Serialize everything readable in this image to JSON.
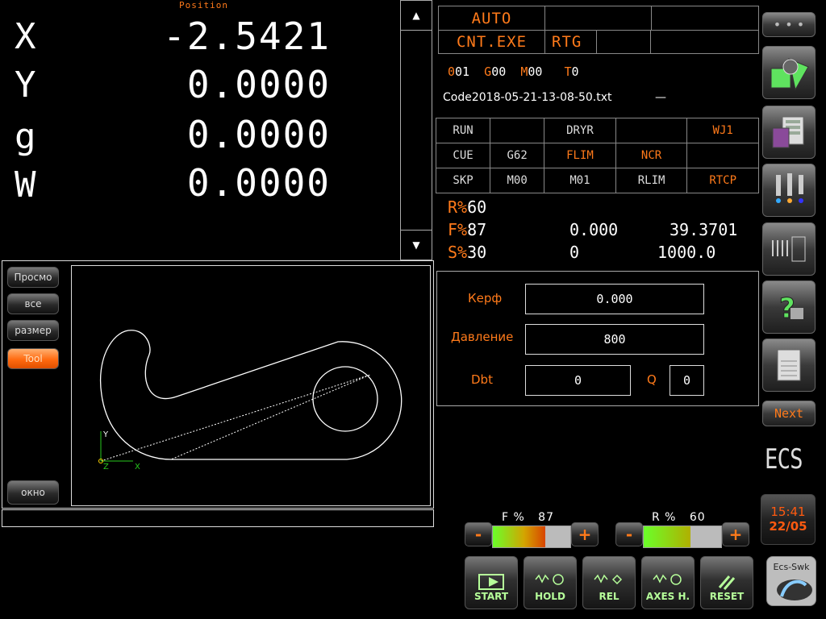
{
  "position": {
    "title": "Position",
    "axes": [
      {
        "name": "X",
        "value": "-2.5421"
      },
      {
        "name": "Y",
        "value": "0.0000"
      },
      {
        "name": "g",
        "value": "0.0000"
      },
      {
        "name": "W",
        "value": "0.0000"
      }
    ]
  },
  "mode": {
    "auto": "AUTO",
    "cnt": "CNT.EXE",
    "rtg": "RTG"
  },
  "gcodes": {
    "n": "001",
    "g": "G00",
    "m": "M00",
    "t": "T0",
    "n_key": "0",
    "n_val": "01",
    "g_key": "G",
    "g_val": "00",
    "m_key": "M",
    "m_val": "00",
    "t_key": "T",
    "t_val": "0"
  },
  "file": {
    "name": "Code2018-05-21-13-08-50.txt",
    "dash": "—"
  },
  "status_table": [
    [
      {
        "t": "RUN",
        "c": "#ddd"
      },
      {
        "t": "",
        "c": "#ddd"
      },
      {
        "t": "DRYR",
        "c": "#ddd"
      },
      {
        "t": "",
        "c": "#ddd"
      },
      {
        "t": "WJ1",
        "c": "#ff7a1a"
      }
    ],
    [
      {
        "t": "CUE",
        "c": "#ddd"
      },
      {
        "t": "G62",
        "c": "#ddd"
      },
      {
        "t": "FLIM",
        "c": "#ff7a1a"
      },
      {
        "t": "NCR",
        "c": "#ff7a1a"
      },
      {
        "t": "",
        "c": "#ddd"
      }
    ],
    [
      {
        "t": "SKP",
        "c": "#ddd"
      },
      {
        "t": "M00",
        "c": "#ddd"
      },
      {
        "t": "M01",
        "c": "#ddd"
      },
      {
        "t": "RLIM",
        "c": "#ddd"
      },
      {
        "t": "RTCP",
        "c": "#ff7a1a"
      }
    ]
  ],
  "rates": {
    "r_label": "R%",
    "r_val": "60",
    "f_label": "F%",
    "f_val": "87",
    "f_v1": "0.000",
    "f_v2": "39.3701",
    "s_label": "S%",
    "s_val": "30",
    "s_v1": "0",
    "s_v2": "1000.0"
  },
  "params": {
    "kerf_label": "Керф",
    "kerf_value": "0.000",
    "pressure_label": "Давление",
    "pressure_value": "800",
    "dbt_label": "Dbt",
    "dbt_value": "0",
    "q_label": "Q",
    "q_value": "0"
  },
  "preview": {
    "buttons": [
      "Просмо",
      "все",
      "размер",
      "Tool"
    ],
    "ok": "окно",
    "axis_y": "Y",
    "axis_x": "X",
    "axis_z": "Z"
  },
  "sidebar": {
    "next": "Next",
    "logo": "ECS",
    "time": "15:41",
    "date": "22/05",
    "badge": "Ecs-Swk"
  },
  "overrides": {
    "f_label": "F %",
    "f_value": "87",
    "f_fraction": 0.68,
    "r_label": "R %",
    "r_value": "60",
    "r_fraction": 0.6,
    "minus": "-",
    "plus": "+"
  },
  "commands": [
    "START",
    "HOLD",
    "REL",
    "AXES H.",
    "RESET"
  ],
  "colors": {
    "accent": "#ff7a1a",
    "green": "#b6ff9a",
    "bg": "#000000"
  }
}
